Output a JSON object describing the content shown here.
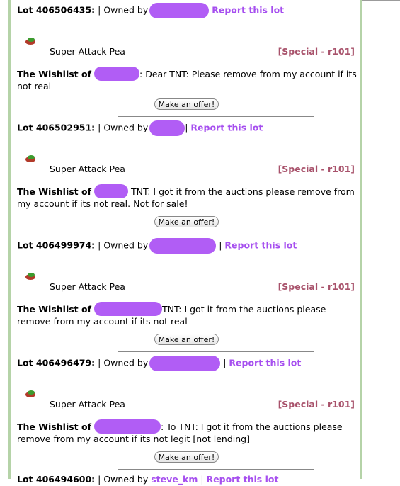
{
  "owned_by_label": "| Owned by",
  "report_label": "Report this lot",
  "offer_label": "Make an offer!",
  "wishlist_label": "The Wishlist of",
  "lots": [
    {
      "number": "Lot 406506435:",
      "item": "",
      "rarity": "",
      "message": "",
      "show_offer": false
    },
    {
      "number": "Lot 406502951:",
      "item": "Super Attack Pea",
      "rarity": "[Special - r101]",
      "message": ": Dear TNT: Please remove from my account if its not real"
    },
    {
      "number": "Lot 406499974:",
      "item": "Super Attack Pea",
      "rarity": "[Special - r101]",
      "message": "TNT: I got it from the auctions please remove from my account if its not real. Not for sale!"
    },
    {
      "number": "Lot 406496479:",
      "item": "Super Attack Pea",
      "rarity": "[Special - r101]",
      "message": "TNT: I got it from the auctions please remove from my account if its not real"
    },
    {
      "number": "Lot 406494600:",
      "owner": "steve_km",
      "item": "Super Attack Pea",
      "rarity": "[Special - r101]",
      "message": ": To TNT: I got it from the auctions please remove from my account if its not legit [not lending]"
    }
  ],
  "colors": {
    "report": "#a64fef",
    "rarity": "#a8526b",
    "border": "#b5d3a8",
    "redaction": "#b15df5"
  },
  "icons": {
    "item_icon": "pea-icon"
  }
}
